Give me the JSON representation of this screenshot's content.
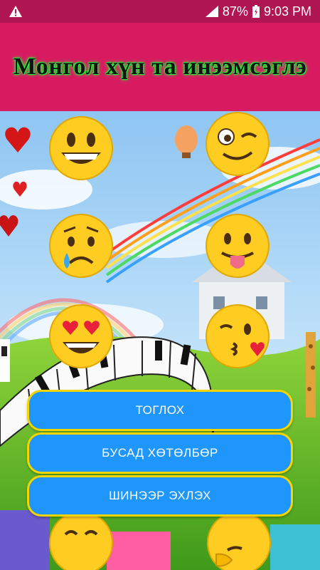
{
  "status_bar": {
    "battery": "87%",
    "time": "9:03 PM",
    "icons": [
      "warning-icon",
      "signal-icon",
      "battery-icon"
    ]
  },
  "header": {
    "title": "Монгол хүн та инээмсэглэ",
    "background": "#d81b60",
    "glow": "#21ff3a"
  },
  "emojis": [
    "grinning-face",
    "winking-face",
    "crying-face",
    "tongue-out-face",
    "heart-eyes-face",
    "kissing-face",
    "smiling-face",
    "thinking-face"
  ],
  "menu": {
    "play_label": "ТОГЛОХ",
    "other_apps_label": "БУСАД ХӨТӨЛБӨР",
    "restart_label": "ШИНЭЭР ЭХЛЭХ",
    "button_color": "#1e96fb",
    "border_color": "#f5d400"
  }
}
